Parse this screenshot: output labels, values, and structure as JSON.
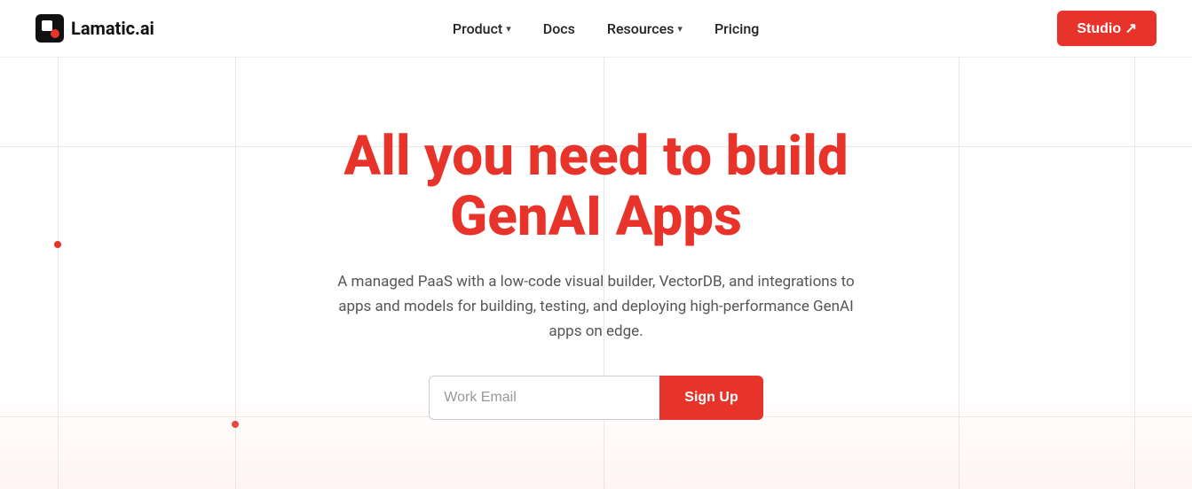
{
  "brand": {
    "name": "Lamatic.ai"
  },
  "navbar": {
    "logo_alt": "Lamatic.ai logo",
    "nav_items": [
      {
        "label": "Product",
        "has_dropdown": true
      },
      {
        "label": "Docs",
        "has_dropdown": false
      },
      {
        "label": "Resources",
        "has_dropdown": true
      },
      {
        "label": "Pricing",
        "has_dropdown": false
      }
    ],
    "studio_label": "Studio ↗"
  },
  "hero": {
    "title_line1": "All you need to build",
    "title_line2": "GenAI Apps",
    "subtitle": "A managed PaaS with a low-code visual builder, VectorDB, and integrations to apps and models for building, testing, and deploying high-performance GenAI apps on edge.",
    "email_placeholder": "Work Email",
    "signup_label": "Sign Up"
  },
  "colors": {
    "brand_red": "#e8332a",
    "text_dark": "#111",
    "text_mid": "#555",
    "border": "#ccc"
  }
}
